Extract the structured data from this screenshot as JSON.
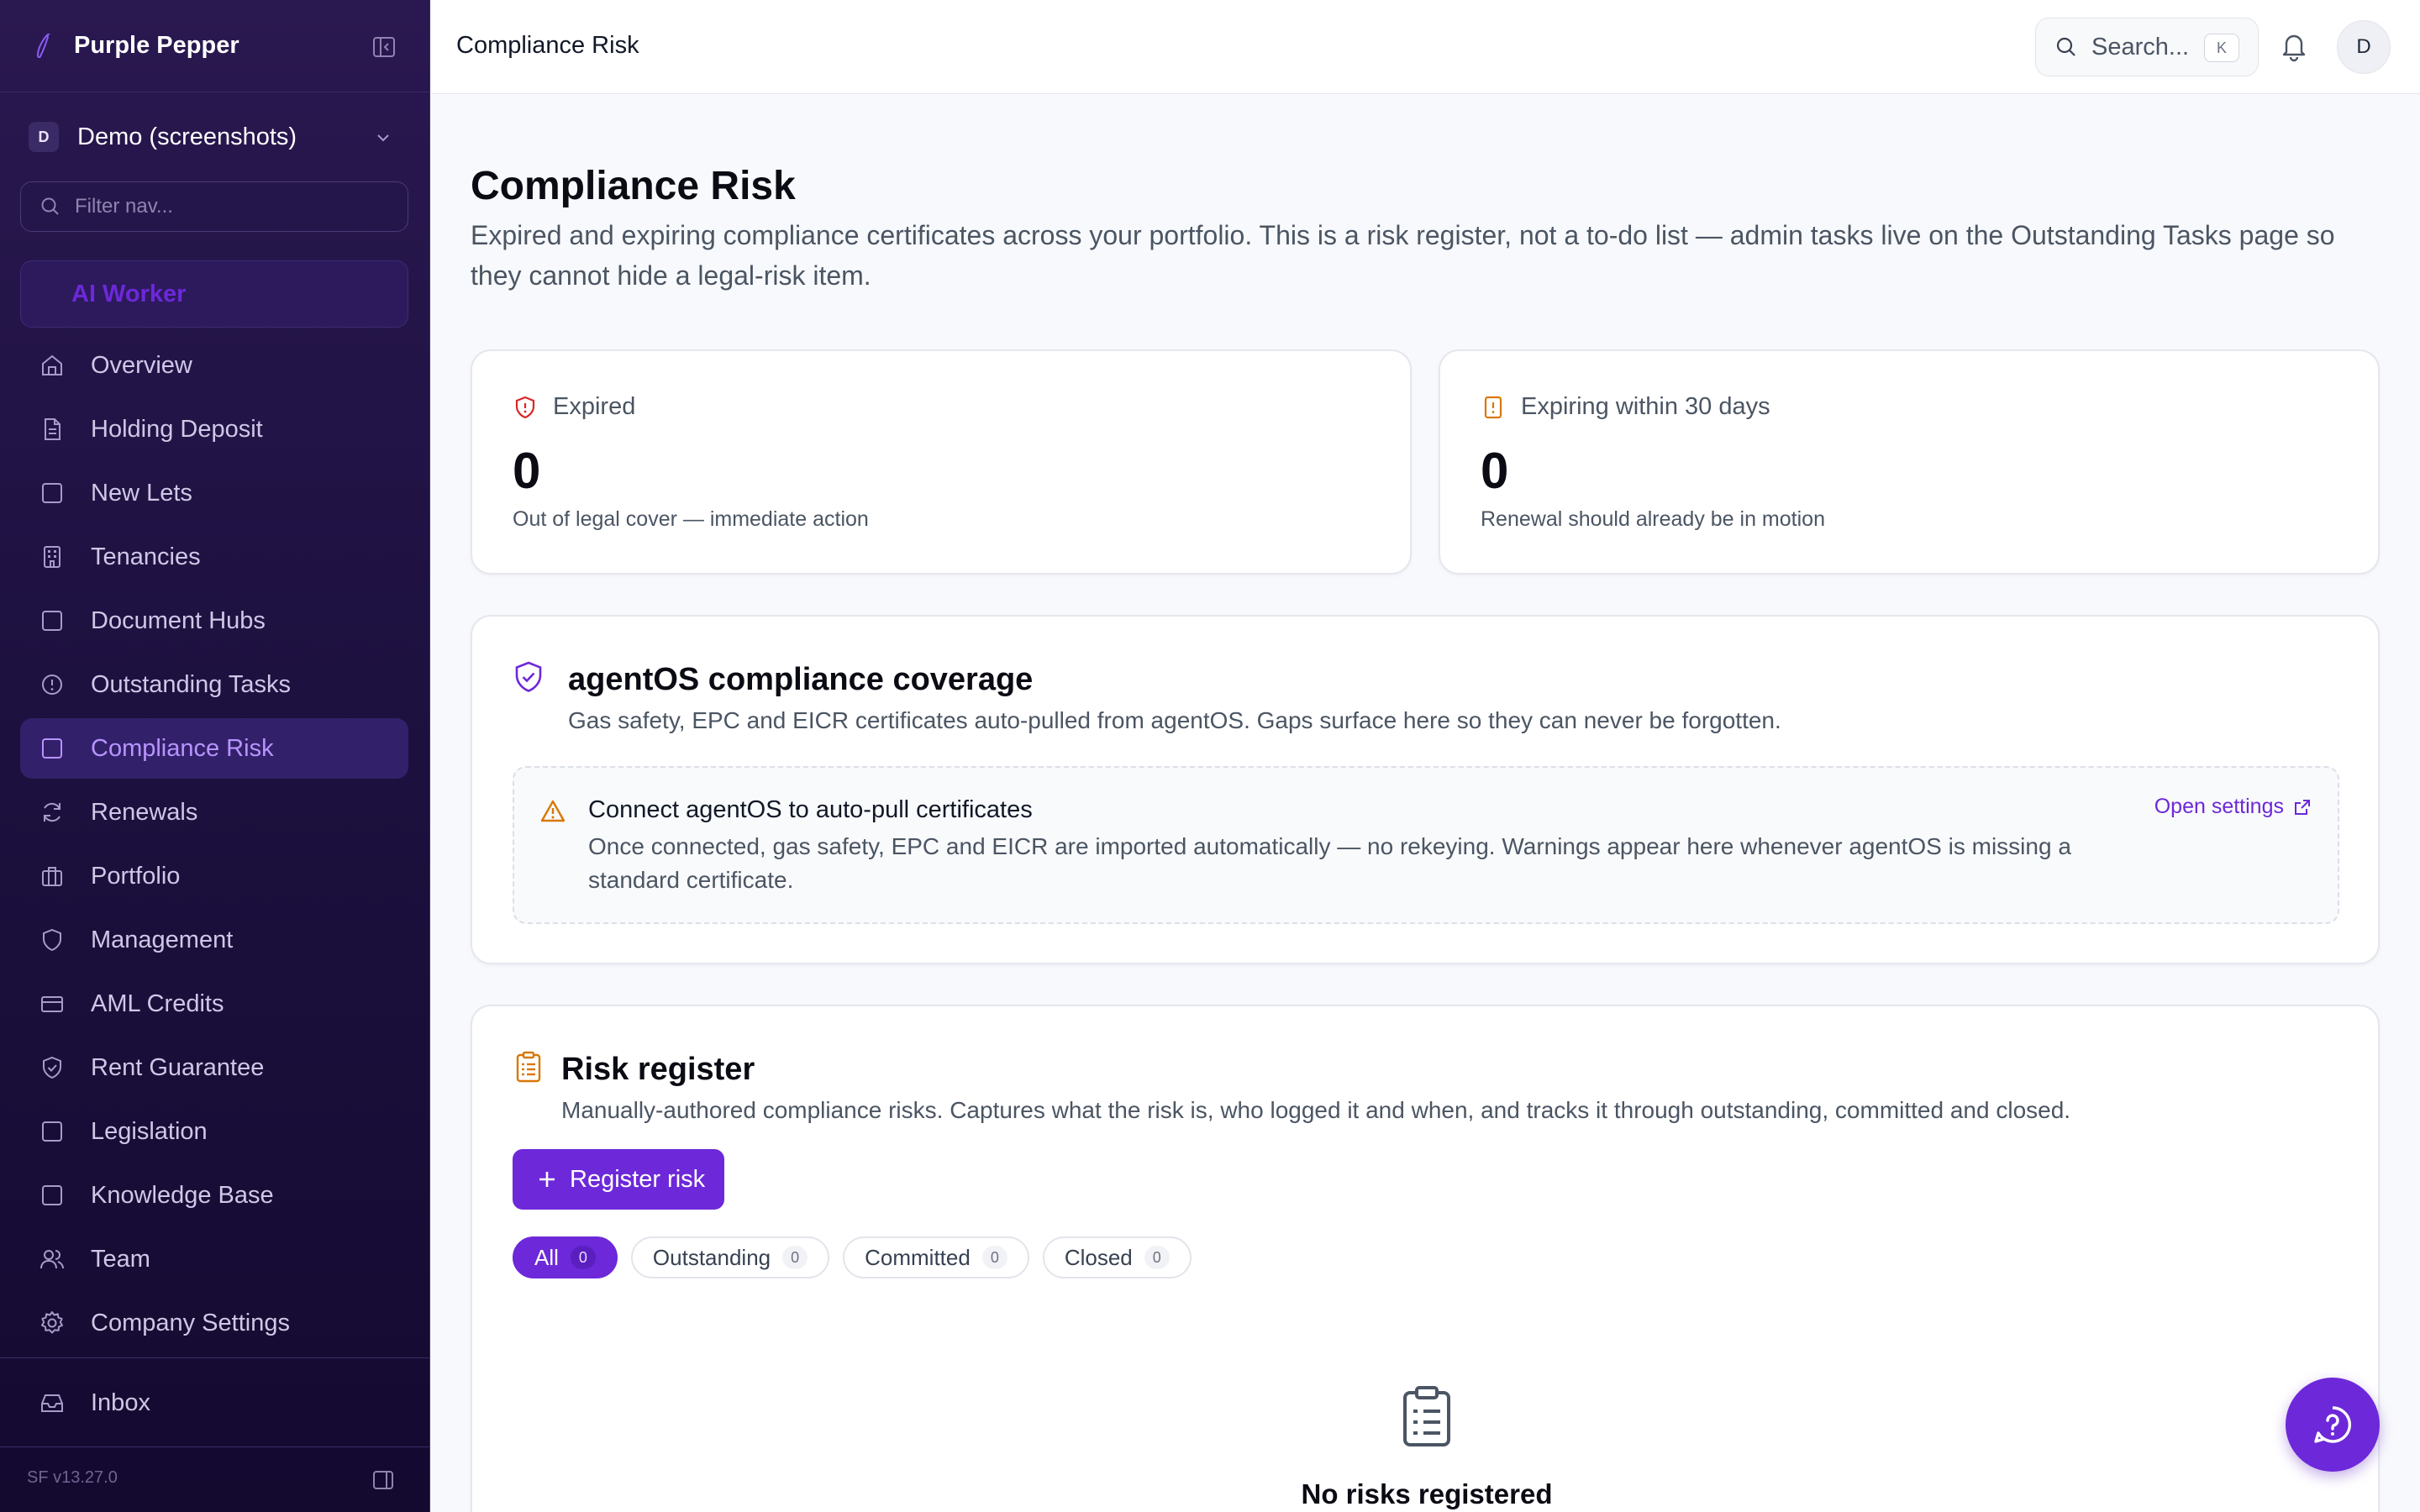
{
  "app": {
    "name": "Purple Pepper",
    "version": "SF v13.27.0"
  },
  "workspace": {
    "initial": "D",
    "name": "Demo (screenshots)"
  },
  "sidebar": {
    "filter_placeholder": "Filter nav...",
    "ai_worker_label": "AI Worker",
    "items": [
      {
        "label": "Overview",
        "icon": "home-icon"
      },
      {
        "label": "Holding Deposit",
        "icon": "document-icon"
      },
      {
        "label": "New Lets",
        "icon": "square-icon"
      },
      {
        "label": "Tenancies",
        "icon": "building-icon"
      },
      {
        "label": "Document Hubs",
        "icon": "square-icon"
      },
      {
        "label": "Outstanding Tasks",
        "icon": "alert-circle-icon"
      },
      {
        "label": "Compliance Risk",
        "icon": "square-icon",
        "active": true
      },
      {
        "label": "Renewals",
        "icon": "refresh-icon"
      },
      {
        "label": "Portfolio",
        "icon": "briefcase-icon"
      },
      {
        "label": "Management",
        "icon": "shield-icon"
      },
      {
        "label": "AML Credits",
        "icon": "credit-card-icon"
      },
      {
        "label": "Rent Guarantee",
        "icon": "shield-check-icon"
      },
      {
        "label": "Legislation",
        "icon": "square-icon"
      },
      {
        "label": "Knowledge Base",
        "icon": "square-icon"
      },
      {
        "label": "Team",
        "icon": "users-icon"
      },
      {
        "label": "Company Settings",
        "icon": "gear-icon"
      }
    ],
    "inbox_label": "Inbox"
  },
  "topbar": {
    "title": "Compliance Risk",
    "search_label": "Search...",
    "search_shortcut": "K",
    "user_initial": "D"
  },
  "page": {
    "title": "Compliance Risk",
    "description": "Expired and expiring compliance certificates across your portfolio. This is a risk register, not a to-do list — admin tasks live on the Outstanding Tasks page so they cannot hide a legal-risk item."
  },
  "stats": {
    "expired": {
      "label": "Expired",
      "value": "0",
      "sub": "Out of legal cover — immediate action"
    },
    "expiring": {
      "label": "Expiring within 30 days",
      "value": "0",
      "sub": "Renewal should already be in motion"
    }
  },
  "coverage": {
    "title": "agentOS compliance coverage",
    "description": "Gas safety, EPC and EICR certificates auto-pulled from agentOS. Gaps surface here so they can never be forgotten.",
    "notice_title": "Connect agentOS to auto-pull certificates",
    "notice_body": "Once connected, gas safety, EPC and EICR are imported automatically — no rekeying. Warnings appear here whenever agentOS is missing a standard certificate.",
    "open_settings": "Open settings"
  },
  "register": {
    "title": "Risk register",
    "description": "Manually-authored compliance risks. Captures what the risk is, who logged it and when, and tracks it through outstanding, committed and closed.",
    "button_label": "Register risk",
    "filters": [
      {
        "label": "All",
        "count": "0",
        "active": true
      },
      {
        "label": "Outstanding",
        "count": "0"
      },
      {
        "label": "Committed",
        "count": "0"
      },
      {
        "label": "Closed",
        "count": "0"
      }
    ],
    "empty_title": "No risks registered"
  },
  "colors": {
    "accent": "#6d28d9",
    "sidebar_bg": "#1d1140",
    "expired_icon": "#dc2626",
    "warning_icon": "#d97706"
  }
}
